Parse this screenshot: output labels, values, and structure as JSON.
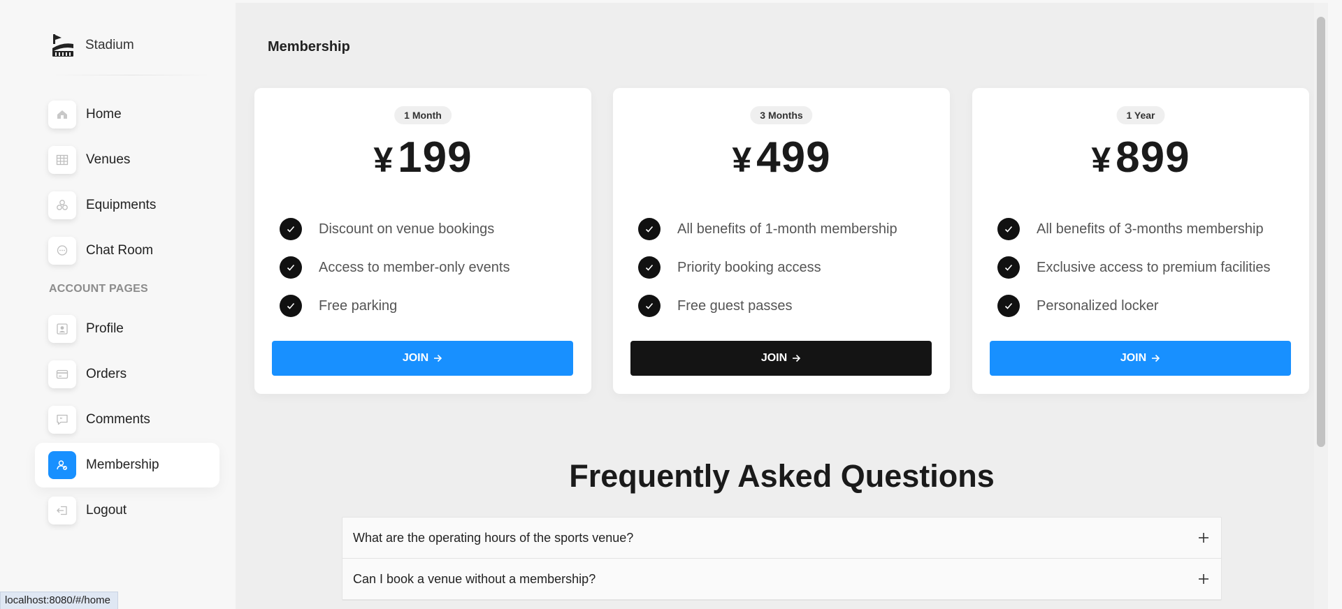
{
  "brand": {
    "name": "Stadium",
    "logo_icon": "stadium-logo-icon"
  },
  "sidebar": {
    "items": [
      {
        "label": "Home",
        "icon": "home-icon"
      },
      {
        "label": "Venues",
        "icon": "table-grid-icon"
      },
      {
        "label": "Equipments",
        "icon": "cubes-icon"
      },
      {
        "label": "Chat Room",
        "icon": "chat-bubble-icon"
      }
    ],
    "section_title": "ACCOUNT PAGES",
    "account_items": [
      {
        "label": "Profile",
        "icon": "profile-card-icon"
      },
      {
        "label": "Orders",
        "icon": "credit-card-icon"
      },
      {
        "label": "Comments",
        "icon": "quote-comment-icon"
      },
      {
        "label": "Membership",
        "icon": "member-badge-icon",
        "active": true
      },
      {
        "label": "Logout",
        "icon": "logout-icon"
      }
    ]
  },
  "page": {
    "title": "Membership"
  },
  "plans": [
    {
      "period": "1 Month",
      "currency": "¥",
      "price": "199",
      "features": [
        "Discount on venue bookings",
        "Access to member-only events",
        "Free parking"
      ],
      "button": "JOIN",
      "button_style": "primary"
    },
    {
      "period": "3 Months",
      "currency": "¥",
      "price": "499",
      "features": [
        "All benefits of 1-month membership",
        "Priority booking access",
        "Free guest passes"
      ],
      "button": "JOIN",
      "button_style": "dark"
    },
    {
      "period": "1 Year",
      "currency": "¥",
      "price": "899",
      "features": [
        "All benefits of 3-months membership",
        "Exclusive access to premium facilities",
        "Personalized locker"
      ],
      "button": "JOIN",
      "button_style": "primary"
    }
  ],
  "faq": {
    "title": "Frequently Asked Questions",
    "items": [
      "What are the operating hours of the sports venue?",
      "Can I book a venue without a membership?"
    ]
  },
  "status_bar": {
    "url": "localhost:8080/#/home"
  },
  "colors": {
    "primary": "#1890ff",
    "dark": "#141414",
    "check": "#111111"
  }
}
